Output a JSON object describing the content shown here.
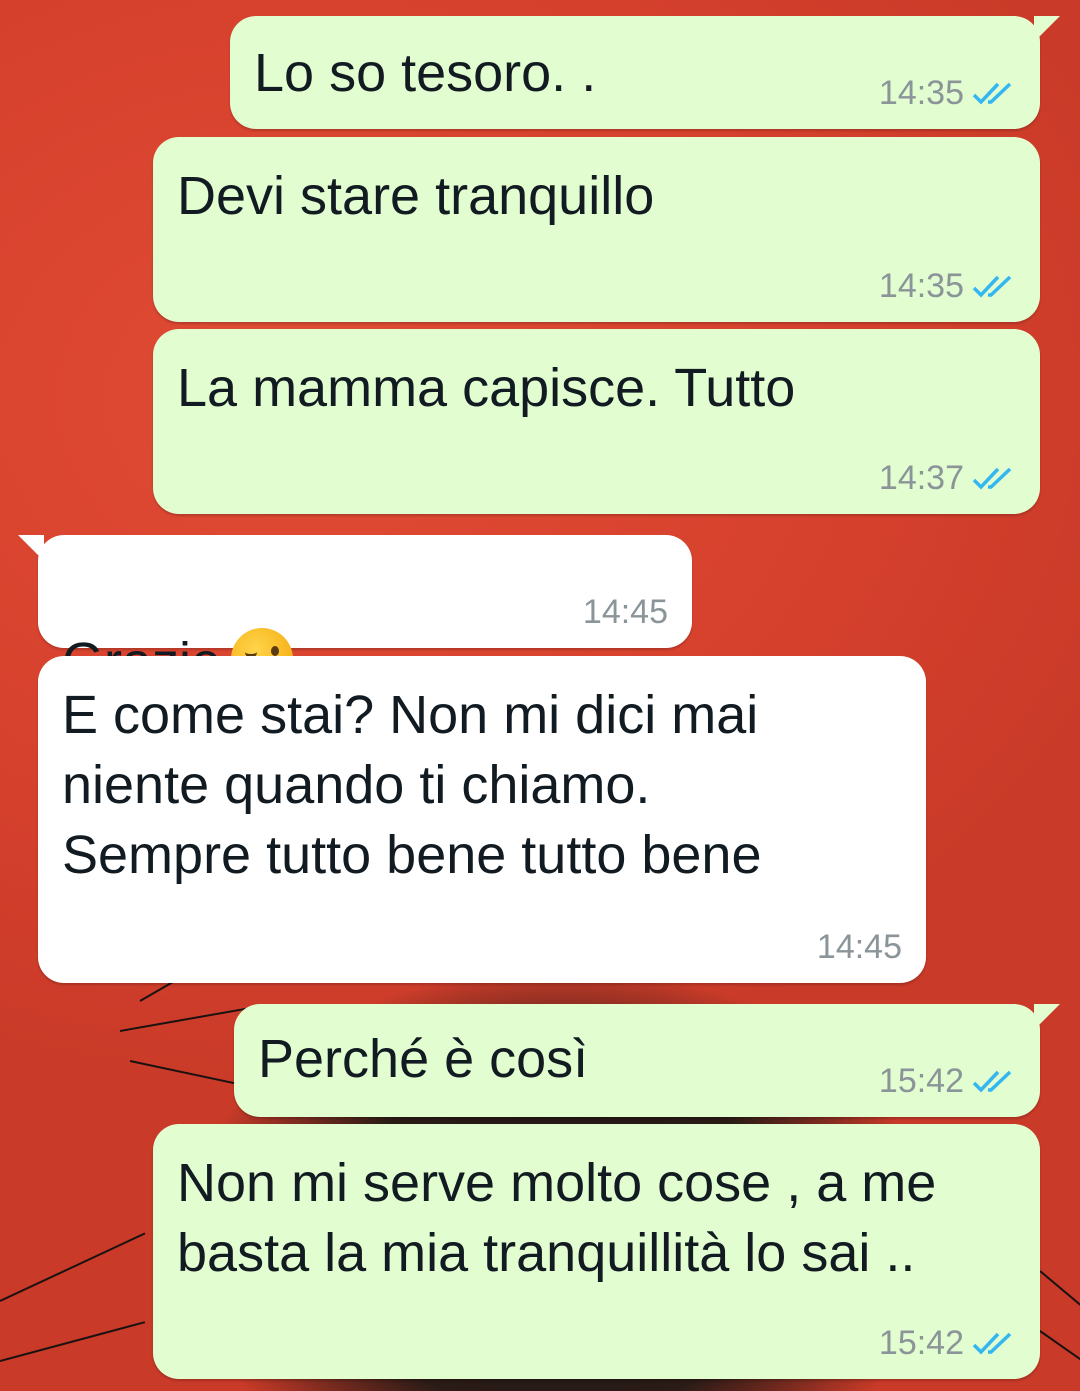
{
  "chat": {
    "messages": [
      {
        "text": "Lo so tesoro. .",
        "time": "14:35"
      },
      {
        "text": "Devi stare tranquillo",
        "time": "14:35"
      },
      {
        "text": "La mamma capisce. Tutto",
        "time": "14:37"
      },
      {
        "text": "Grazie",
        "time": "14:45",
        "emoji": "kiss-heart-emoji"
      },
      {
        "text": "E come stai? Non mi dici mai\nniente quando ti chiamo.\nSempre tutto bene tutto bene",
        "time": "14:45"
      },
      {
        "text": "Perché è così",
        "time": "15:42"
      },
      {
        "text": "Non mi serve molto cose , a me\nbasta la mia tranquillità lo sai ..",
        "time": "15:42"
      }
    ]
  },
  "colors": {
    "outgoing_bubble": "#e2fdd0",
    "incoming_bubble": "#ffffff",
    "read_ticks": "#34b7f1",
    "wallpaper": "#d8432f"
  }
}
